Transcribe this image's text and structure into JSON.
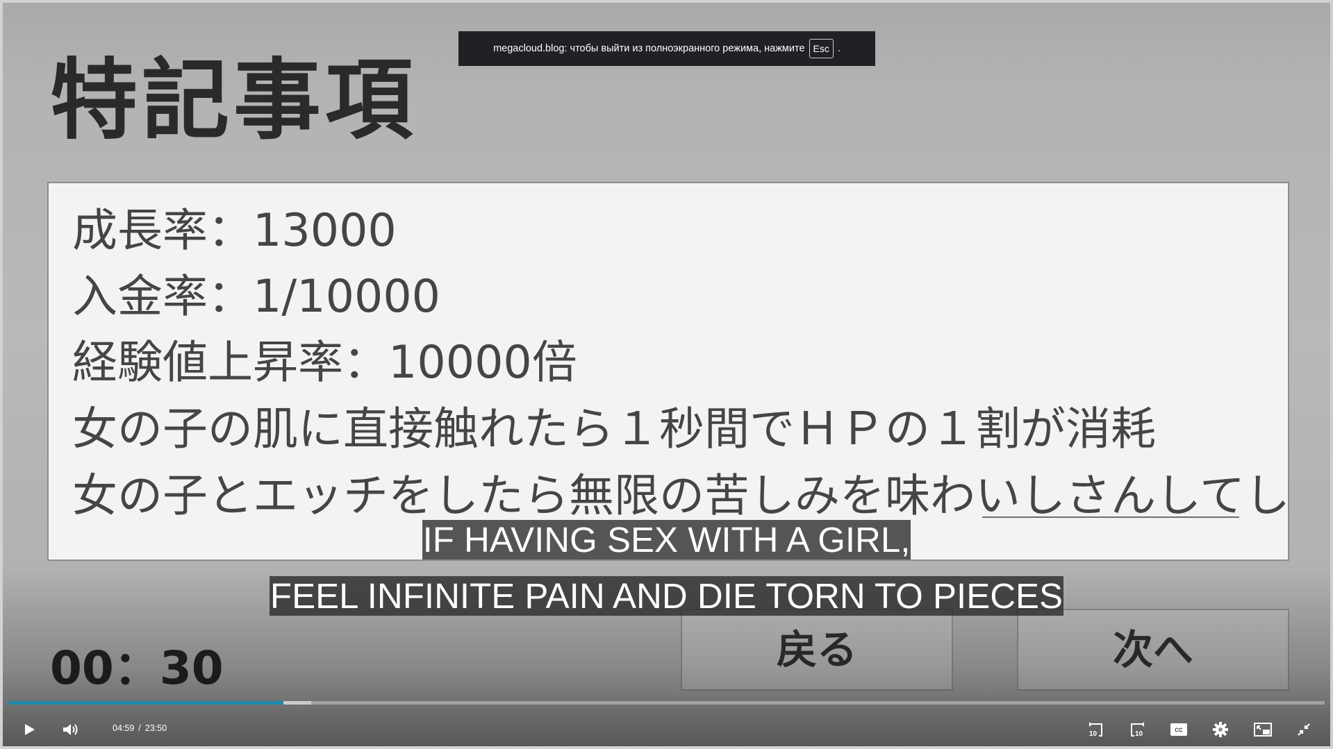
{
  "fullscreen_notice": {
    "message": "megacloud.blog: чтобы выйти из полноэкранного режима, нажмите",
    "key": "Esc",
    "suffix": "."
  },
  "video_frame": {
    "title": "特記事項",
    "notes": [
      "成長率：13000",
      "入金率：1/10000",
      "経験値上昇率：10000倍",
      "女の子の肌に直接触れたら１秒間でＨＰの１割が消耗",
      "女の子とエッチをしたら無限の苦しみを味わいしさんしてし"
    ],
    "buttons": {
      "back": "戻る",
      "next": "次へ"
    },
    "timer": "00：30"
  },
  "subtitles": [
    "IF HAVING SEX WITH A GIRL,",
    "FEEL INFINITE PAIN AND DIE TORN TO PIECES"
  ],
  "player": {
    "current_time": "04:59",
    "separator": "/",
    "duration": "23:50",
    "progress": 0.209,
    "buffered": 0.23,
    "accent_color": "#1e88a8",
    "controls": {
      "play": "play-icon",
      "volume": "volume-icon",
      "rewind": "rewind-10-icon",
      "forward": "forward-10-icon",
      "captions": "captions-icon",
      "settings": "gear-icon",
      "pip": "picture-in-picture-icon",
      "exit_fullscreen": "exit-fullscreen-icon"
    },
    "captions_label": "CC",
    "skip_label": "10"
  }
}
